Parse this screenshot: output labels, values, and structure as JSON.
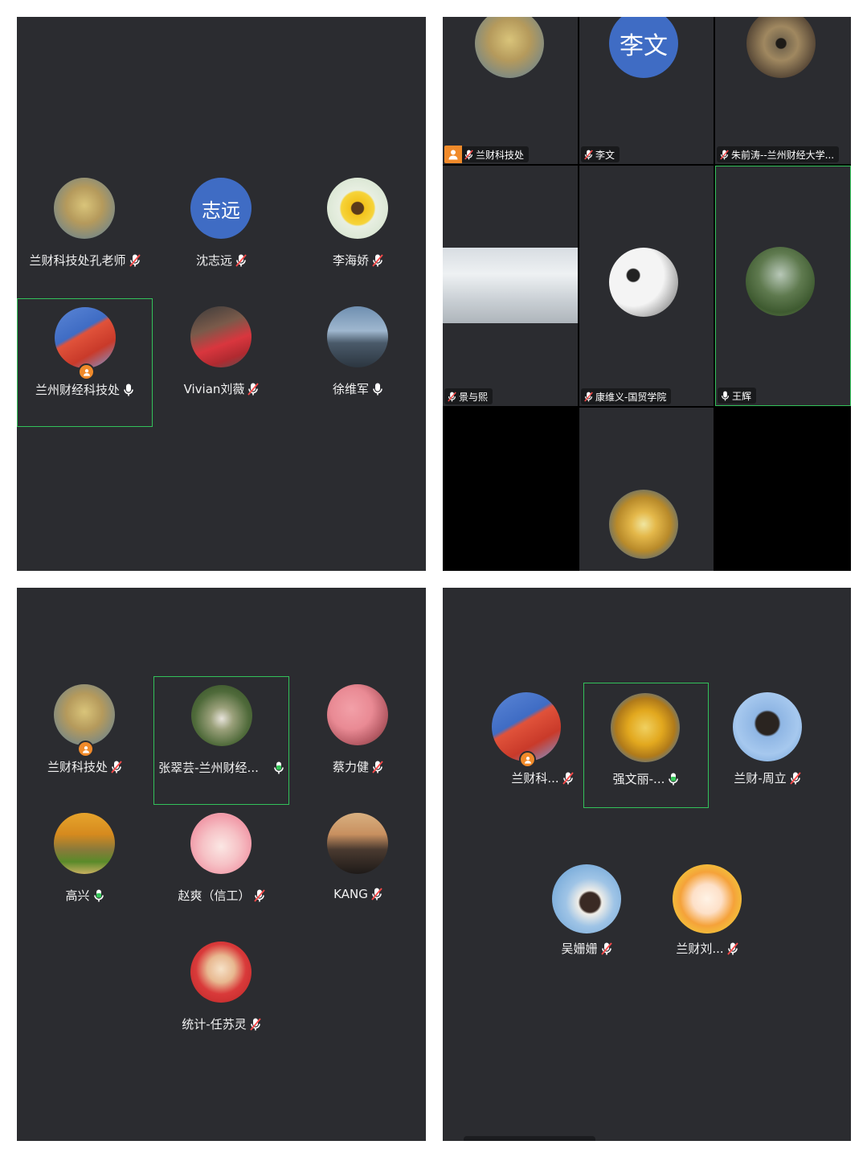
{
  "panel1": {
    "participants": [
      {
        "name": "兰财科技处孔老师",
        "mic": "muted"
      },
      {
        "name": "沈志远",
        "mic": "muted",
        "avatar_text": "志远"
      },
      {
        "name": "李海娇",
        "mic": "muted"
      },
      {
        "name": "兰州财经科技处",
        "mic": "on",
        "host": true,
        "active_speaker": true
      },
      {
        "name": "Vivian刘薇",
        "mic": "muted"
      },
      {
        "name": "徐维军",
        "mic": "on"
      }
    ]
  },
  "panel2": {
    "tiles": [
      {
        "name": "兰财科技处",
        "mic": "muted",
        "host": true
      },
      {
        "name": "李文",
        "mic": "muted",
        "avatar_text": "李文"
      },
      {
        "name": "朱前涛--兰州财经大学...",
        "mic": "muted"
      },
      {
        "name": "景与熙",
        "mic": "muted"
      },
      {
        "name": "康维义-国贸学院",
        "mic": "muted"
      },
      {
        "name": "王辉",
        "mic": "on",
        "active_speaker": true
      }
    ]
  },
  "panel3": {
    "participants": [
      {
        "name": "兰财科技处",
        "mic": "muted",
        "host": true
      },
      {
        "name": "张翠芸-兰州财经...",
        "mic": "on-green",
        "active_speaker": true
      },
      {
        "name": "蔡力健",
        "mic": "muted"
      },
      {
        "name": "高兴",
        "mic": "on-green"
      },
      {
        "name": "赵爽（信工）",
        "mic": "muted"
      },
      {
        "name": "KANG",
        "mic": "muted"
      },
      {
        "name": "统计-任苏灵",
        "mic": "muted"
      }
    ]
  },
  "panel4": {
    "participants": [
      {
        "name": "兰财科...",
        "mic": "muted",
        "host": true
      },
      {
        "name": "强文丽-...",
        "mic": "on-green",
        "active_speaker": true
      },
      {
        "name": "兰财-周立",
        "mic": "muted"
      },
      {
        "name": "吴姗姗",
        "mic": "muted"
      },
      {
        "name": "兰财刘...",
        "mic": "muted"
      }
    ]
  },
  "colors": {
    "panel_bg": "#2b2c30",
    "active_border": "#33c15a",
    "host_badge": "#f08a2a",
    "avatar_blue": "#3f6cc4",
    "mic_on_green": "#35c759"
  }
}
